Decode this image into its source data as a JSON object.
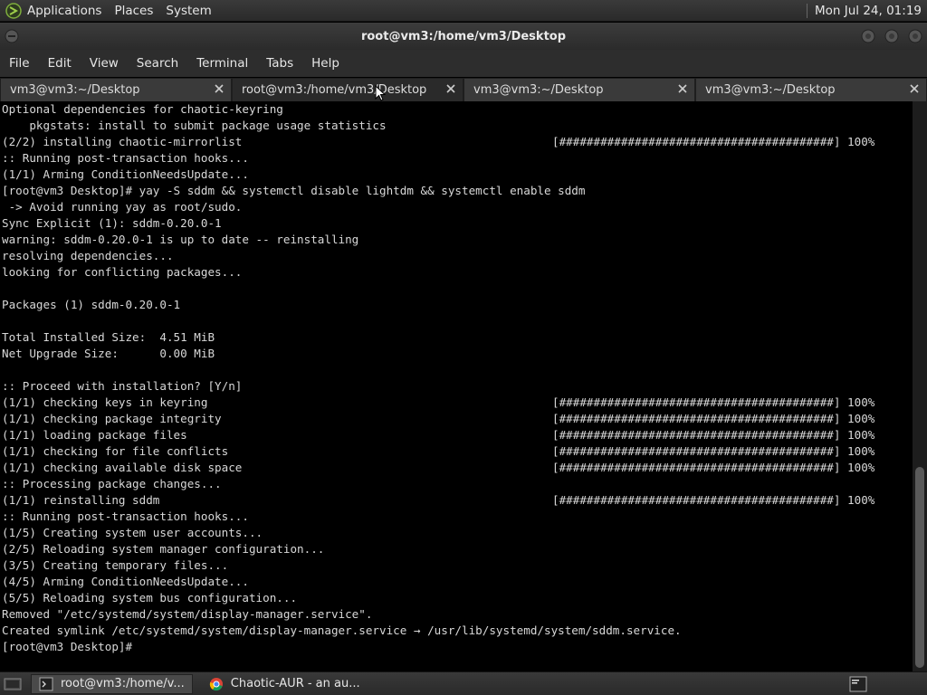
{
  "top_panel": {
    "menus": [
      "Applications",
      "Places",
      "System"
    ],
    "clock": "Mon Jul 24, 01:19",
    "icon": "distro-icon"
  },
  "window": {
    "title": "root@vm3:/home/vm3/Desktop"
  },
  "menubar": {
    "items": [
      "File",
      "Edit",
      "View",
      "Search",
      "Terminal",
      "Tabs",
      "Help"
    ]
  },
  "tabs": [
    {
      "label": "vm3@vm3:~/Desktop",
      "active": false
    },
    {
      "label": "root@vm3:/home/vm3/Desktop",
      "active": true
    },
    {
      "label": "vm3@vm3:~/Desktop",
      "active": false
    },
    {
      "label": "vm3@vm3:~/Desktop",
      "active": false
    }
  ],
  "terminal": {
    "lines": [
      {
        "text": "Optional dependencies for chaotic-keyring",
        "right": ""
      },
      {
        "text": "    pkgstats: install to submit package usage statistics",
        "right": ""
      },
      {
        "text": "(2/2) installing chaotic-mirrorlist",
        "right": "[########################################] 100%"
      },
      {
        "text": ":: Running post-transaction hooks...",
        "right": ""
      },
      {
        "text": "(1/1) Arming ConditionNeedsUpdate...",
        "right": ""
      },
      {
        "text": "[root@vm3 Desktop]# yay -S sddm && systemctl disable lightdm && systemctl enable sddm",
        "right": ""
      },
      {
        "text": " -> Avoid running yay as root/sudo.",
        "right": ""
      },
      {
        "text": "Sync Explicit (1): sddm-0.20.0-1",
        "right": ""
      },
      {
        "text": "warning: sddm-0.20.0-1 is up to date -- reinstalling",
        "right": ""
      },
      {
        "text": "resolving dependencies...",
        "right": ""
      },
      {
        "text": "looking for conflicting packages...",
        "right": ""
      },
      {
        "text": "",
        "right": ""
      },
      {
        "text": "Packages (1) sddm-0.20.0-1",
        "right": ""
      },
      {
        "text": "",
        "right": ""
      },
      {
        "text": "Total Installed Size:  4.51 MiB",
        "right": ""
      },
      {
        "text": "Net Upgrade Size:      0.00 MiB",
        "right": ""
      },
      {
        "text": "",
        "right": ""
      },
      {
        "text": ":: Proceed with installation? [Y/n]",
        "right": ""
      },
      {
        "text": "(1/1) checking keys in keyring",
        "right": "[########################################] 100%"
      },
      {
        "text": "(1/1) checking package integrity",
        "right": "[########################################] 100%"
      },
      {
        "text": "(1/1) loading package files",
        "right": "[########################################] 100%"
      },
      {
        "text": "(1/1) checking for file conflicts",
        "right": "[########################################] 100%"
      },
      {
        "text": "(1/1) checking available disk space",
        "right": "[########################################] 100%"
      },
      {
        "text": ":: Processing package changes...",
        "right": ""
      },
      {
        "text": "(1/1) reinstalling sddm",
        "right": "[########################################] 100%"
      },
      {
        "text": ":: Running post-transaction hooks...",
        "right": ""
      },
      {
        "text": "(1/5) Creating system user accounts...",
        "right": ""
      },
      {
        "text": "(2/5) Reloading system manager configuration...",
        "right": ""
      },
      {
        "text": "(3/5) Creating temporary files...",
        "right": ""
      },
      {
        "text": "(4/5) Arming ConditionNeedsUpdate...",
        "right": ""
      },
      {
        "text": "(5/5) Reloading system bus configuration...",
        "right": ""
      },
      {
        "text": "Removed \"/etc/systemd/system/display-manager.service\".",
        "right": ""
      },
      {
        "text": "Created symlink /etc/systemd/system/display-manager.service → /usr/lib/systemd/system/sddm.service.",
        "right": ""
      },
      {
        "text": "[root@vm3 Desktop]# ",
        "right": ""
      }
    ]
  },
  "taskbar": {
    "items": [
      {
        "label": "root@vm3:/home/v...",
        "icon": "terminal-icon",
        "active": true
      },
      {
        "label": "Chaotic-AUR - an au...",
        "icon": "chrome-icon",
        "active": false
      }
    ]
  }
}
